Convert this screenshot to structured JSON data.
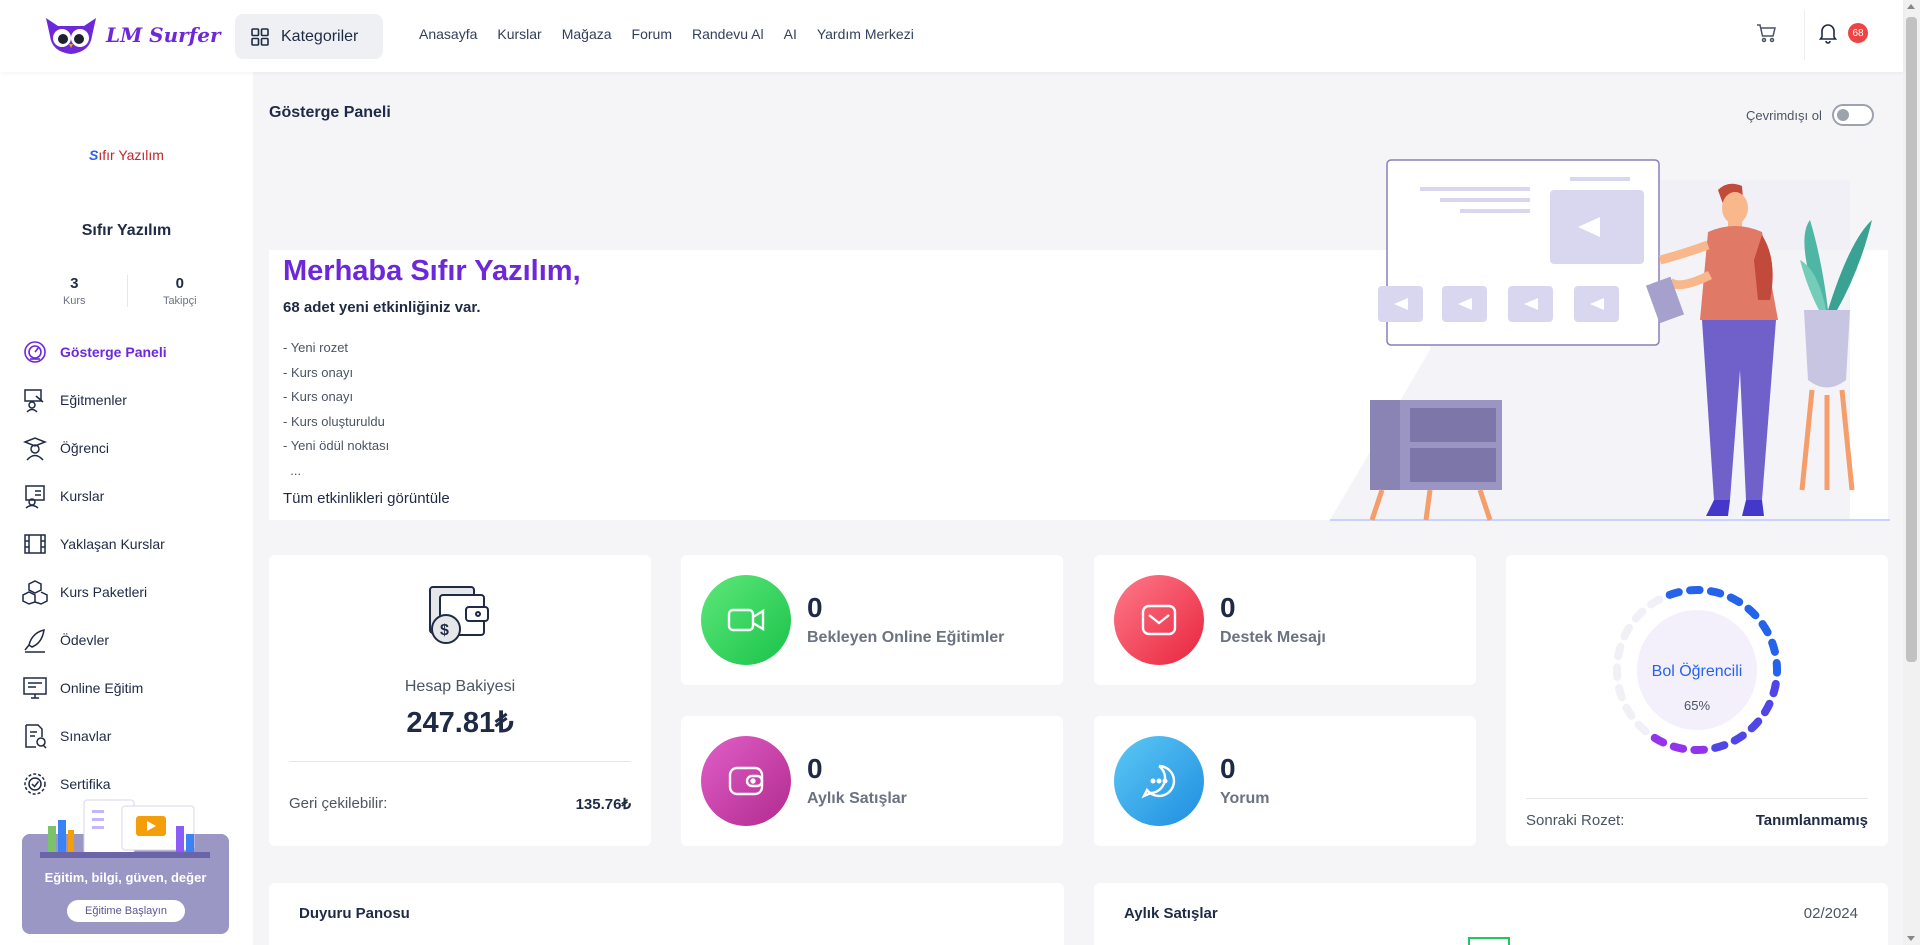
{
  "app": {
    "logo_text": "LM Surfer"
  },
  "topbar": {
    "categories_label": "Kategoriler",
    "nav": [
      "Anasayfa",
      "Kurslar",
      "Mağaza",
      "Forum",
      "Randevu Al",
      "AI",
      "Yardım Merkezi"
    ],
    "notification_count": "68"
  },
  "sidebar": {
    "brand_s": "S",
    "brand_rest": "ıfır Yazılım",
    "name": "Sıfır Yazılım",
    "stats": [
      {
        "value": "3",
        "label": "Kurs"
      },
      {
        "value": "0",
        "label": "Takipçi"
      }
    ],
    "menu": [
      {
        "label": "Gösterge Paneli",
        "icon": "dashboard-icon",
        "active": true
      },
      {
        "label": "Eğitmenler",
        "icon": "instructor-icon"
      },
      {
        "label": "Öğrenci",
        "icon": "student-icon"
      },
      {
        "label": "Kurslar",
        "icon": "courses-icon"
      },
      {
        "label": "Yaklaşan Kurslar",
        "icon": "film-icon"
      },
      {
        "label": "Kurs Paketleri",
        "icon": "boxes-icon"
      },
      {
        "label": "Ödevler",
        "icon": "pen-icon"
      },
      {
        "label": "Online Eğitim",
        "icon": "monitor-icon"
      },
      {
        "label": "Sınavlar",
        "icon": "exam-icon"
      },
      {
        "label": "Sertifika",
        "icon": "certificate-icon"
      }
    ],
    "promo_text": "Eğitim, bilgi, güven, değer",
    "promo_button": "Eğitime Başlayın"
  },
  "main": {
    "page_title": "Gösterge Paneli",
    "offline_label": "Çevrimdışı ol",
    "welcome": {
      "greeting": "Merhaba Sıfır Yazılım,",
      "subtitle": "68 adet yeni etkinliğiniz var.",
      "activities": [
        "- Yeni rozet",
        "- Kurs onayı",
        "- Kurs onayı",
        "- Kurs oluşturuldu",
        "- Yeni ödül noktası",
        "  ..."
      ],
      "view_all": "Tüm etkinlikleri görüntüle"
    },
    "balance": {
      "label": "Hesap Bakiyesi",
      "value": "247.81₺",
      "withdrawable_label": "Geri çekilebilir:",
      "withdrawable_value": "135.76₺"
    },
    "stats": [
      {
        "value": "0",
        "label": "Bekleyen Online Eğitimler",
        "icon": "video-camera-icon",
        "color_from": "#5ee87a",
        "color_to": "#19c24a"
      },
      {
        "value": "0",
        "label": "Destek Mesajı",
        "icon": "mail-icon",
        "color_from": "#ff7a8a",
        "color_to": "#e8243d"
      },
      {
        "value": "0",
        "label": "Aylık Satışlar",
        "icon": "wallet-icon",
        "color_from": "#e05fc8",
        "color_to": "#b12a8e"
      },
      {
        "value": "0",
        "label": "Yorum",
        "icon": "chat-icon",
        "color_from": "#5cc8f5",
        "color_to": "#1f8ee0"
      }
    ],
    "badge": {
      "title": "Bol Öğrencili",
      "percent": "65%",
      "progress": 0.65,
      "next_label": "Sonraki Rozet:",
      "next_value": "Tanımlanmamış"
    },
    "announcements_title": "Duyuru Panosu",
    "monthly_sales_title": "Aylık Satışlar",
    "monthly_sales_date": "02/2024"
  }
}
